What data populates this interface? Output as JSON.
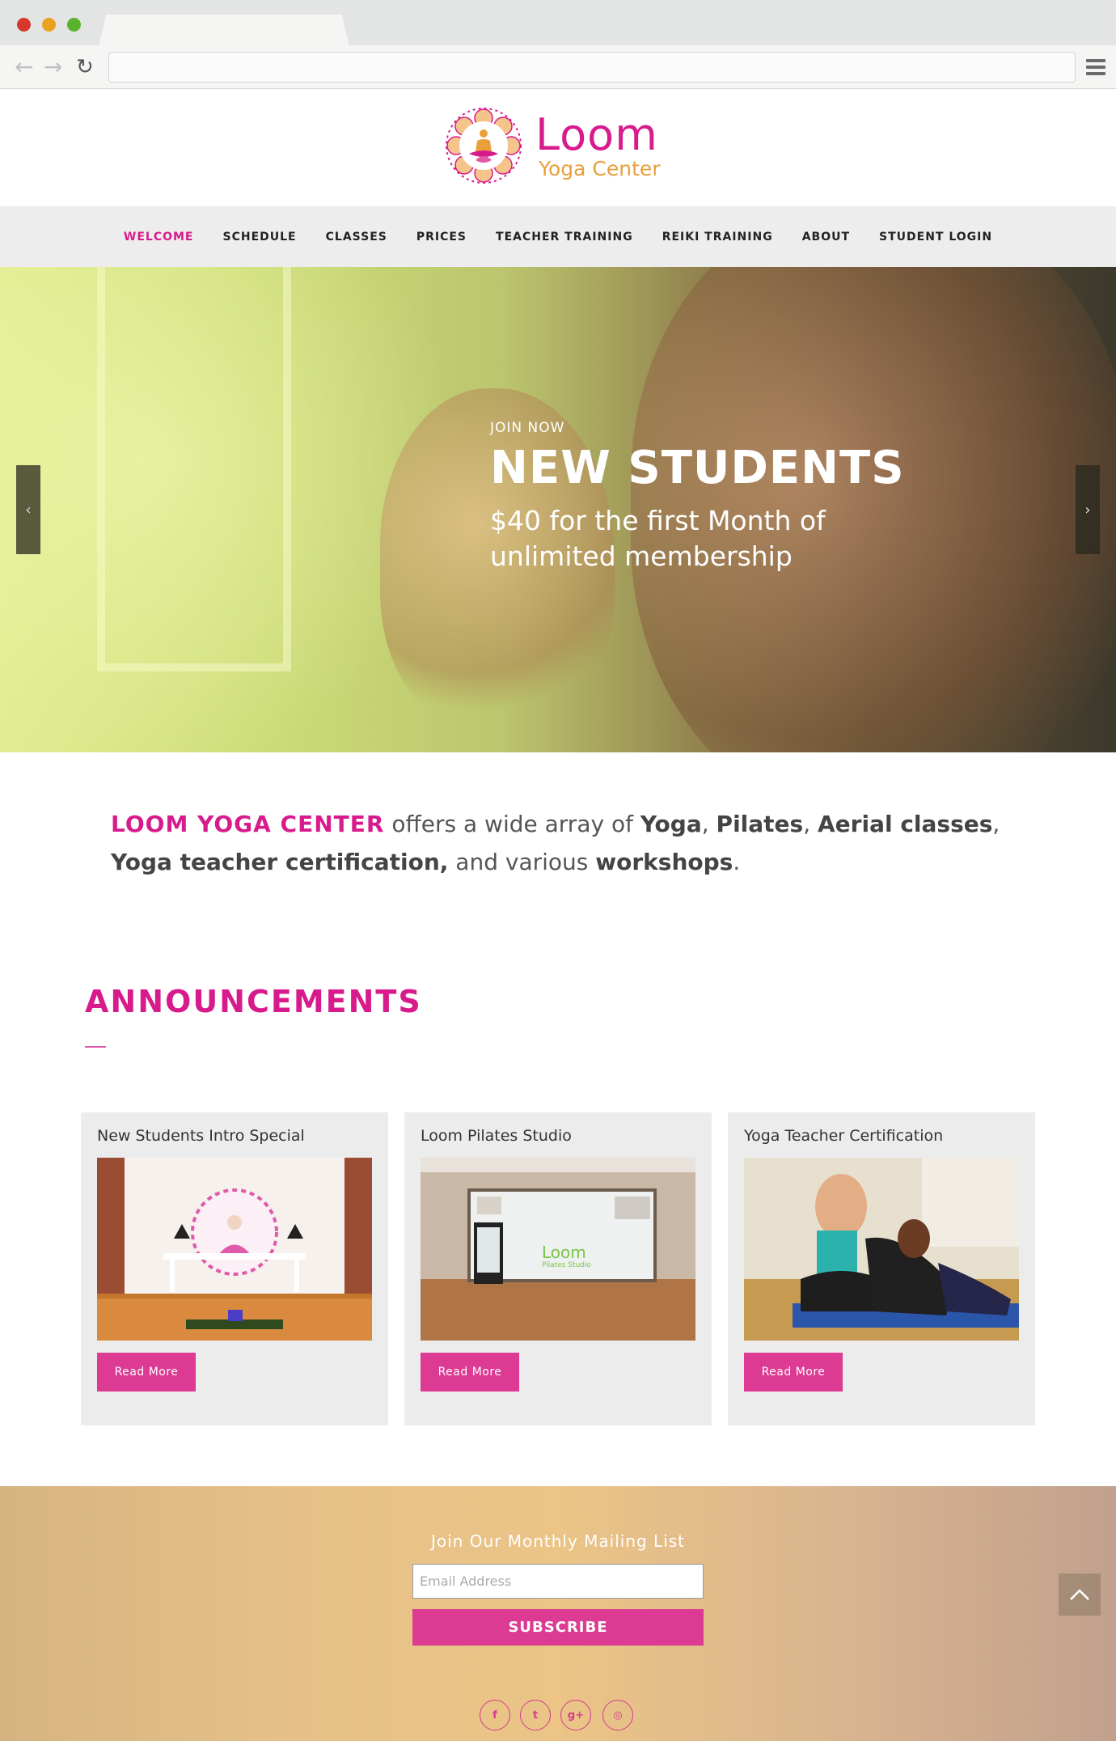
{
  "browser": {
    "url": ""
  },
  "logo": {
    "wordmark": "Loom",
    "subtitle": "Yoga Center"
  },
  "nav": {
    "items": [
      {
        "label": "WELCOME",
        "active": true
      },
      {
        "label": "SCHEDULE",
        "active": false
      },
      {
        "label": "CLASSES",
        "active": false
      },
      {
        "label": "PRICES",
        "active": false
      },
      {
        "label": "TEACHER TRAINING",
        "active": false
      },
      {
        "label": "REIKI TRAINING",
        "active": false
      },
      {
        "label": "ABOUT",
        "active": false
      },
      {
        "label": "STUDENT LOGIN",
        "active": false
      }
    ]
  },
  "hero": {
    "kicker": "JOIN NOW",
    "title": "NEW STUDENTS",
    "subtitle_line1": "$40 for the first Month of",
    "subtitle_line2": "unlimited membership",
    "prev_icon": "chevron-left-icon",
    "next_icon": "chevron-right-icon"
  },
  "intro": {
    "brand": "LOOM YOGA CENTER",
    "t1": " offers a wide array of ",
    "b1": "Yoga",
    "t2": ", ",
    "b2": "Pilates",
    "t3": ", ",
    "b3": "Aerial classes",
    "t4": ",",
    "b4": "Yoga teacher certification,",
    "t5": " and various ",
    "b5": "workshops",
    "t6": "."
  },
  "announcements": {
    "heading": "ANNOUNCEMENTS",
    "cards": [
      {
        "title": "New Students Intro Special",
        "button": "Read More"
      },
      {
        "title": "Loom Pilates Studio",
        "button": "Read More",
        "sign_word": "Loom",
        "sign_sub": "Pilates Studio"
      },
      {
        "title": "Yoga Teacher Certification",
        "button": "Read More"
      }
    ]
  },
  "footer": {
    "mailing_title": "Join Our Monthly Mailing List",
    "email_placeholder": "Email Address",
    "subscribe_label": "SUBSCRIBE",
    "social": [
      {
        "icon": "facebook-icon",
        "glyph": "f"
      },
      {
        "icon": "twitter-icon",
        "glyph": "t"
      },
      {
        "icon": "google-plus-icon",
        "glyph": "g+"
      },
      {
        "icon": "instagram-icon",
        "glyph": "◎"
      }
    ],
    "to_top_icon": "chevron-up-icon"
  },
  "colors": {
    "brand_pink": "#d81b8c",
    "button_pink": "#dd3b93",
    "logo_orange": "#e9a03b"
  }
}
